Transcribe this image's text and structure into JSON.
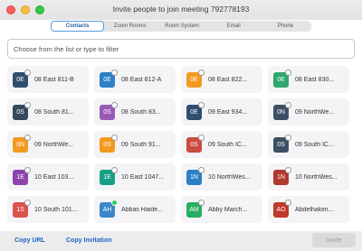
{
  "window": {
    "title": "Invite people to join meeting 792778193"
  },
  "tabs": [
    {
      "label": "Contacts",
      "active": true
    },
    {
      "label": "Zoom Rooms",
      "active": false
    },
    {
      "label": "Room System",
      "active": false
    },
    {
      "label": "Email",
      "active": false
    },
    {
      "label": "Phone",
      "active": false
    }
  ],
  "filter": {
    "placeholder": "Choose from the list or type to filter",
    "value": ""
  },
  "contacts": [
    {
      "initials": "0E",
      "name": "08 East 811-B",
      "color": "#2f4f6e",
      "status": "offline"
    },
    {
      "initials": "0E",
      "name": "08 East 812-A",
      "color": "#2d7fc7",
      "status": "offline"
    },
    {
      "initials": "0E",
      "name": "08 East 822...",
      "color": "#f29a1f",
      "status": "offline"
    },
    {
      "initials": "0E",
      "name": "08 East 830...",
      "color": "#2fa86b",
      "status": "offline"
    },
    {
      "initials": "0S",
      "name": "08 South 81...",
      "color": "#34495e",
      "status": "offline"
    },
    {
      "initials": "0S",
      "name": "08 South 83...",
      "color": "#9b59b6",
      "status": "offline"
    },
    {
      "initials": "0E",
      "name": "09 East 934...",
      "color": "#2f4f6e",
      "status": "offline"
    },
    {
      "initials": "0N",
      "name": "09 NorthWe...",
      "color": "#3d4f63",
      "status": "offline"
    },
    {
      "initials": "0N",
      "name": "09 NorthWe...",
      "color": "#f29a1f",
      "status": "offline"
    },
    {
      "initials": "0S",
      "name": "09 South 91...",
      "color": "#f29a1f",
      "status": "offline"
    },
    {
      "initials": "0S",
      "name": "09 South IC...",
      "color": "#c94b3c",
      "status": "offline"
    },
    {
      "initials": "0S",
      "name": "09 South IC...",
      "color": "#3d4f63",
      "status": "offline"
    },
    {
      "initials": "1E",
      "name": "10 East 103...",
      "color": "#8e44ad",
      "status": "offline"
    },
    {
      "initials": "1E",
      "name": "10 East 1047...",
      "color": "#16a085",
      "status": "offline"
    },
    {
      "initials": "1N",
      "name": "10 NorthWes...",
      "color": "#2d7fc7",
      "status": "offline"
    },
    {
      "initials": "1N",
      "name": "10 NorthWes...",
      "color": "#b03a2e",
      "status": "offline"
    },
    {
      "initials": "1S",
      "name": "10 South 101...",
      "color": "#d9534f",
      "status": "offline"
    },
    {
      "initials": "AH",
      "name": "Abbas Haide...",
      "color": "#3a86c8",
      "status": "online"
    },
    {
      "initials": "AM",
      "name": "Abby March...",
      "color": "#27ae60",
      "status": "offline"
    },
    {
      "initials": "AO",
      "name": "Abdelhakim...",
      "color": "#c0392b",
      "status": "offline"
    }
  ],
  "footer": {
    "copy_url_label": "Copy URL",
    "copy_invitation_label": "Copy Invitation",
    "invite_label": "Invite"
  }
}
